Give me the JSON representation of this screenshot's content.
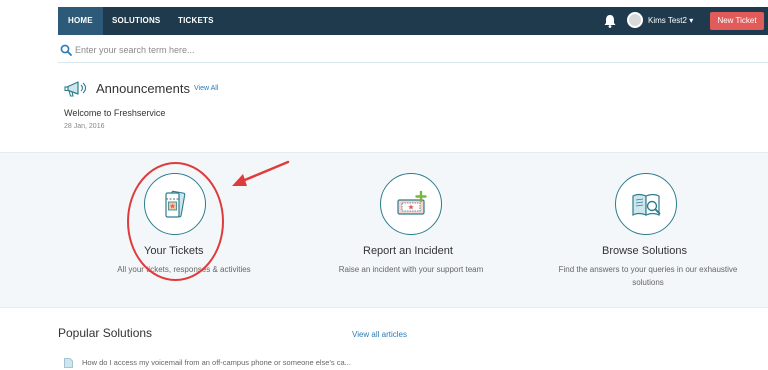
{
  "nav": {
    "tabs": [
      "HOME",
      "SOLUTIONS",
      "TICKETS"
    ],
    "active_tab": "HOME",
    "user_name": "Kims Test2 ▾",
    "new_ticket_label": "New Ticket"
  },
  "search": {
    "placeholder": "Enter your search term here..."
  },
  "announcements": {
    "title": "Announcements",
    "view_all": "View All",
    "item_title": "Welcome to Freshservice",
    "item_date": "28 Jan, 2016"
  },
  "features": [
    {
      "title": "Your Tickets",
      "description": "All your tickets, responses & activities"
    },
    {
      "title": "Report an Incident",
      "description": "Raise an incident with your support team"
    },
    {
      "title": "Browse Solutions",
      "description": "Find the answers to your queries in our exhaustive solutions"
    }
  ],
  "popular": {
    "title": "Popular Solutions",
    "view_all": "View all articles",
    "items": [
      "How do I access my voicemail from an off-campus phone or someone else's ca..."
    ]
  },
  "colors": {
    "navbar": "#1f3a4d",
    "active_tab": "#2d5a78",
    "new_ticket": "#e25b5b",
    "link": "#2b7bb9",
    "accent": "#2e7d8c",
    "annotation": "#e03b3b"
  }
}
